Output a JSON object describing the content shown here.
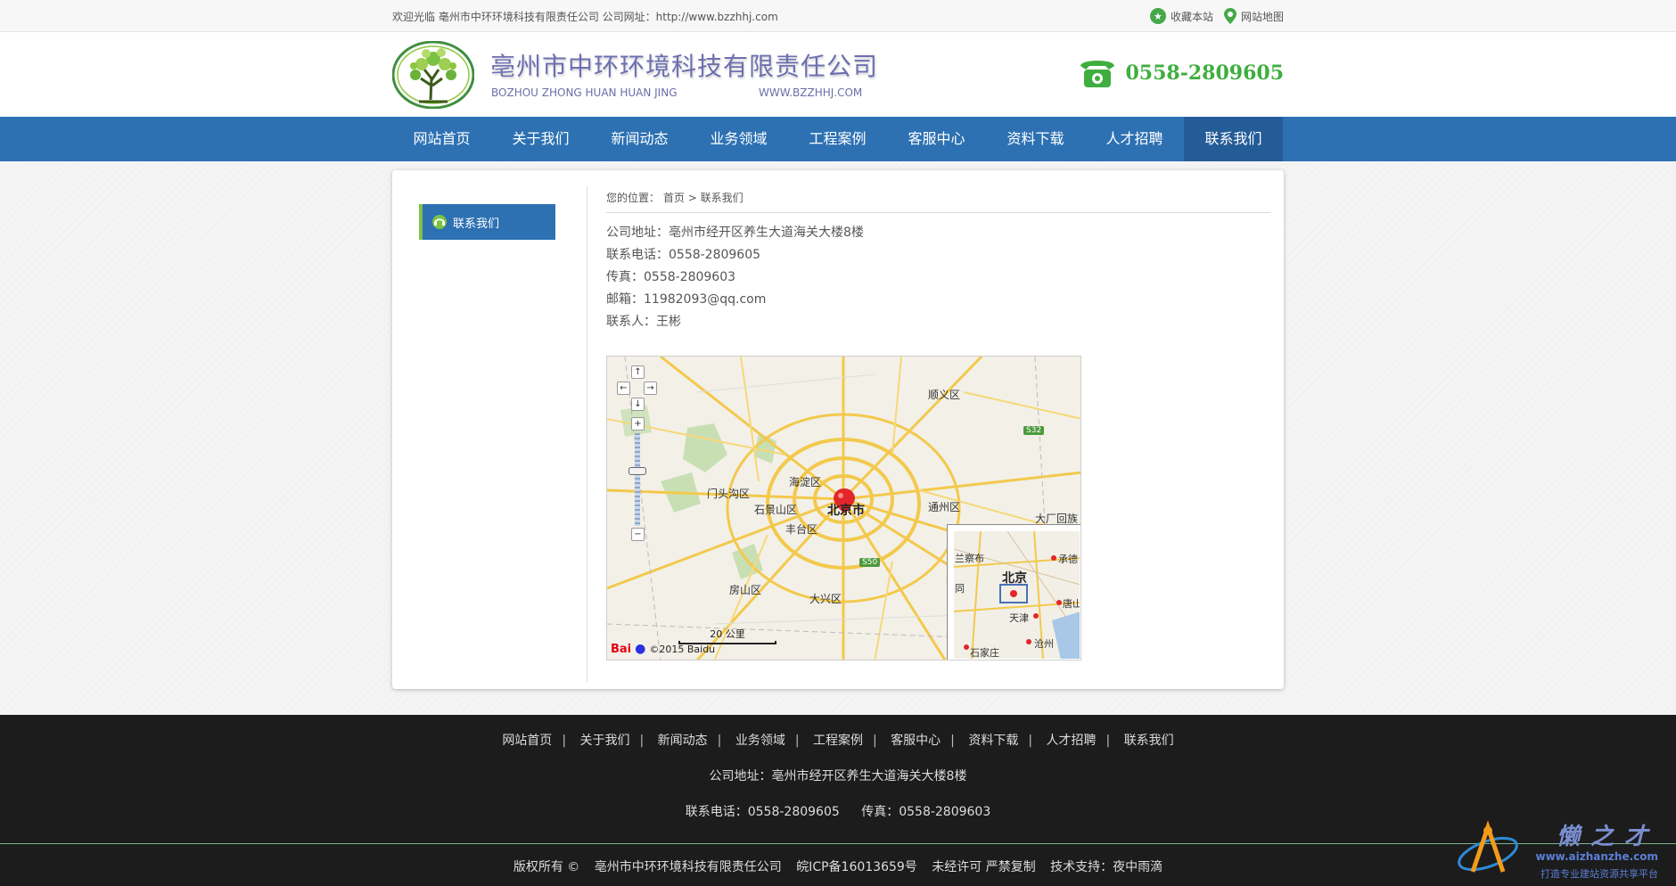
{
  "topbar": {
    "welcome": "欢迎光临 亳州市中环环境科技有限责任公司 公司网址：http://www.bzzhhj.com",
    "bookmark": "收藏本站",
    "sitemap": "网站地图"
  },
  "header": {
    "company_name": "亳州市中环环境科技有限责任公司",
    "pinyin": "BOZHOU ZHONG HUAN HUAN JING",
    "website": "WWW.BZZHHJ.COM",
    "phone": "0558-2809605"
  },
  "nav": {
    "items": [
      "网站首页",
      "关于我们",
      "新闻动态",
      "业务领域",
      "工程案例",
      "客服中心",
      "资料下载",
      "人才招聘",
      "联系我们"
    ],
    "active": "联系我们"
  },
  "sidebar": {
    "item": "联系我们"
  },
  "breadcrumb": {
    "prefix": "您的位置：",
    "home": "首页",
    "sep": ">",
    "current": "联系我们"
  },
  "contact": {
    "address": "公司地址：亳州市经开区养生大道海关大楼8楼",
    "phone": "联系电话：0558-2809605",
    "fax": "传真：0558-2809603",
    "email": "邮箱：11982093@qq.com",
    "person": "联系人：王彬"
  },
  "map": {
    "labels": {
      "shunyi": "顺义区",
      "haidian": "海淀区",
      "mentougou": "门头沟区",
      "shijingshan": "石景山区",
      "beijing": "北京市",
      "tongzhou": "通州区",
      "fengtai": "丰台区",
      "dachang": "大厂回族",
      "fangshan": "房山区",
      "daxing": "大兴区",
      "s32": "S32",
      "s50": "S50"
    },
    "scale": "20 公里",
    "copyright": "©2015 Baidu",
    "logo": "Bai",
    "overview_labels": {
      "chengde": "承德",
      "beijing": "北京",
      "tianjin": "天津",
      "tangshan": "唐山",
      "cangzhou": "沧州",
      "shijiazhuang": "石家庄",
      "wulanchabu": "兰察布",
      "datong": "同"
    }
  },
  "footer": {
    "nav": [
      "网站首页",
      "关于我们",
      "新闻动态",
      "业务领域",
      "工程案例",
      "客服中心",
      "资料下载",
      "人才招聘",
      "联系我们"
    ],
    "address": "公司地址：亳州市经开区养生大道海关大楼8楼",
    "tel": "联系电话：0558-2809605",
    "fax": "传真：0558-2809603",
    "copyright": "版权所有 ©",
    "company": "亳州市中环环境科技有限责任公司",
    "icp": "皖ICP备16013659号",
    "notice": "未经许可 严禁复制",
    "support": "技术支持：夜中雨滴"
  },
  "watermark": {
    "title": "懒之才",
    "url": "www.aizhanzhe.com",
    "slogan": "打造专业建站资源共享平台"
  },
  "colors": {
    "nav_blue": "#2d71b3",
    "nav_active": "#245c98",
    "green": "#3fae3f",
    "footer_bg": "#1c1c1c"
  }
}
